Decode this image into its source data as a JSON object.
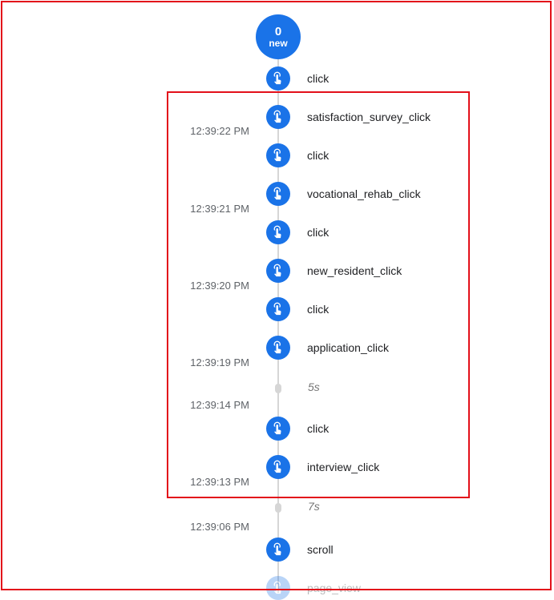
{
  "badge": {
    "count": "0",
    "label": "new"
  },
  "events": [
    {
      "name": "click",
      "icon": "touch-icon"
    },
    {
      "name": "satisfaction_survey_click",
      "icon": "touch-icon"
    },
    {
      "name": "click",
      "icon": "touch-icon"
    },
    {
      "name": "vocational_rehab_click",
      "icon": "touch-icon"
    },
    {
      "name": "click",
      "icon": "touch-icon"
    },
    {
      "name": "new_resident_click",
      "icon": "touch-icon"
    },
    {
      "name": "click",
      "icon": "touch-icon"
    },
    {
      "name": "application_click",
      "icon": "touch-icon"
    },
    {
      "name": "click",
      "icon": "touch-icon"
    },
    {
      "name": "interview_click",
      "icon": "touch-icon"
    },
    {
      "name": "scroll",
      "icon": "touch-icon"
    },
    {
      "name": "page_view",
      "icon": "touch-icon"
    }
  ],
  "timestamps": [
    "12:39:22 PM",
    "12:39:21 PM",
    "12:39:20 PM",
    "12:39:19 PM",
    "12:39:14 PM",
    "12:39:13 PM",
    "12:39:06 PM"
  ],
  "gaps": [
    "5s",
    "7s"
  ],
  "colors": {
    "accent": "#1a73e8",
    "highlight": "#e3101a",
    "line": "#d6d6d6"
  }
}
